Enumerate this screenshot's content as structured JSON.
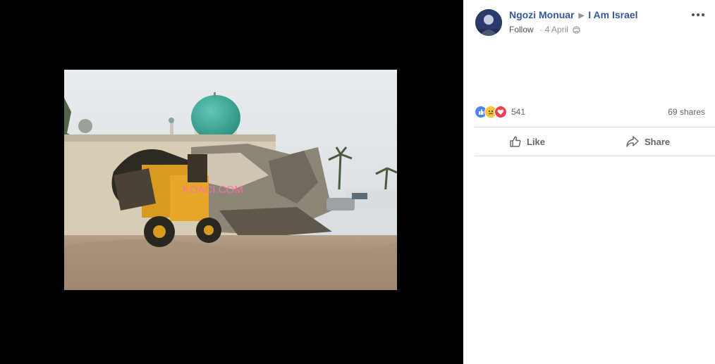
{
  "post": {
    "author": "Ngozi Monuar",
    "group": "I Am Israel",
    "follow_label": "Follow",
    "date": "4 April",
    "avatar_icon": "profile-avatar",
    "privacy_icon": "globe-icon",
    "more_icon": "more-options-icon"
  },
  "photo": {
    "watermark": "KOACI.COM"
  },
  "stats": {
    "reaction_icons": [
      "like-reaction-icon",
      "sad-reaction-icon",
      "love-reaction-icon"
    ],
    "reaction_count": "541",
    "shares": "69 shares"
  },
  "actions": {
    "like_label": "Like",
    "share_label": "Share"
  },
  "colors": {
    "link_blue": "#365899",
    "like_blue": "#4a84f2",
    "sad_yellow": "#f7c43a",
    "love_red": "#ee4150",
    "muted": "#90949c"
  }
}
